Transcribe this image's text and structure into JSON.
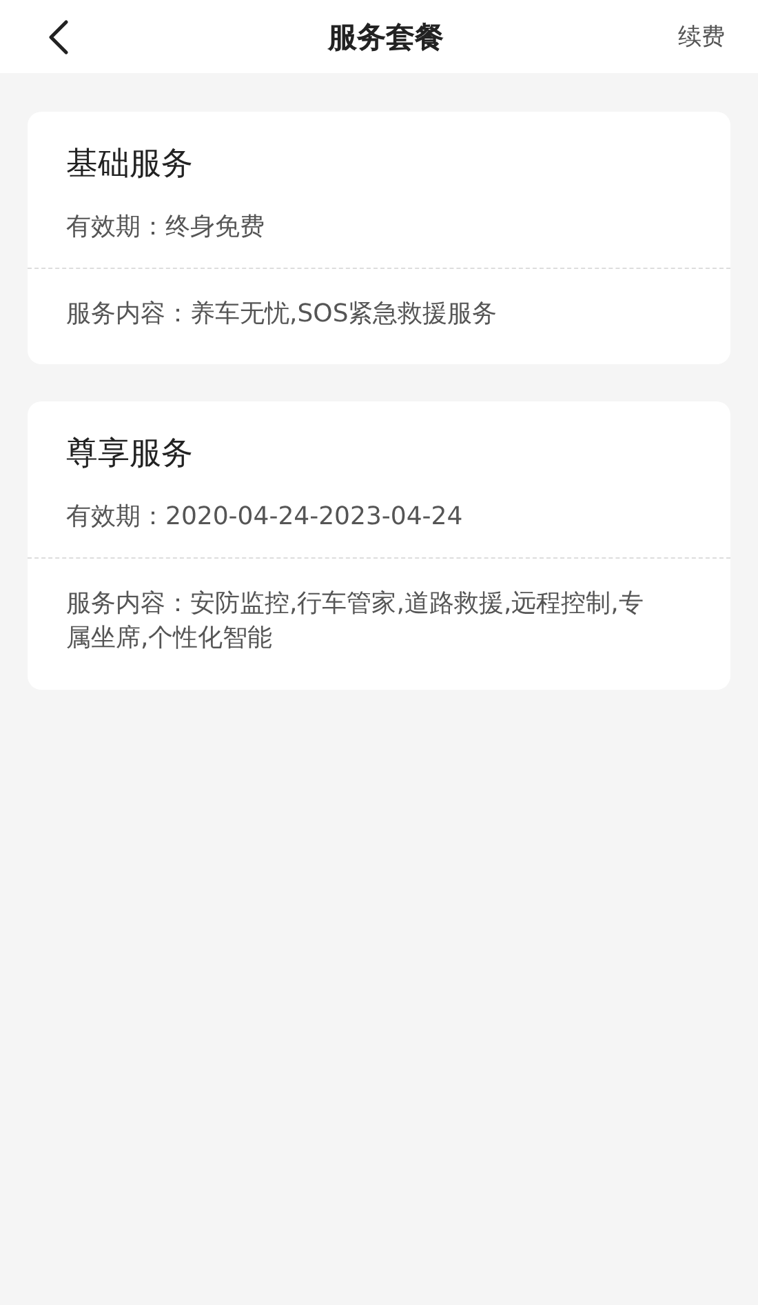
{
  "header": {
    "title": "服务套餐",
    "action": "续费"
  },
  "packages": [
    {
      "name": "基础服务",
      "validity": "有效期：终身免费",
      "content": "服务内容：养车无忧,SOS紧急救援服务"
    },
    {
      "name": "尊享服务",
      "validity": "有效期：2020-04-24-2023-04-24",
      "content": "服务内容：安防监控,行车管家,道路救援,远程控制,专属坐席,个性化智能"
    }
  ]
}
